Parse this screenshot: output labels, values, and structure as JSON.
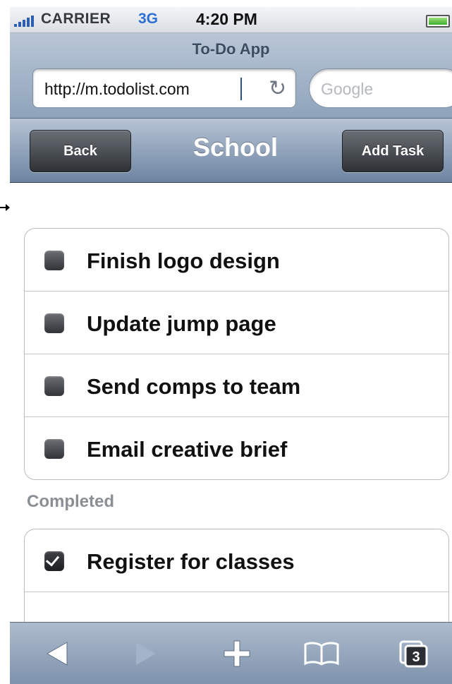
{
  "status": {
    "carrier": "CARRIER",
    "network": "3G",
    "time": "4:20 PM"
  },
  "browser": {
    "page_title": "To-Do App",
    "url": "http://m.todolist.com",
    "search_placeholder": "Google"
  },
  "nav": {
    "back_label": "Back",
    "title": "School",
    "add_label": "Add Task"
  },
  "tasks": [
    {
      "label": "Finish logo design",
      "done": false
    },
    {
      "label": "Update jump page",
      "done": false
    },
    {
      "label": "Send comps to team",
      "done": false
    },
    {
      "label": "Email creative brief",
      "done": false
    }
  ],
  "completed": {
    "header": "Completed",
    "items": [
      {
        "label": "Register for classes",
        "done": true
      },
      {
        "label": "",
        "done": false
      }
    ]
  },
  "toolbar": {
    "tab_count": "3"
  },
  "icons": {
    "toolbar": [
      "back-arrow-icon",
      "forward-arrow-icon",
      "plus-icon",
      "bookmarks-icon",
      "pages-icon"
    ]
  }
}
